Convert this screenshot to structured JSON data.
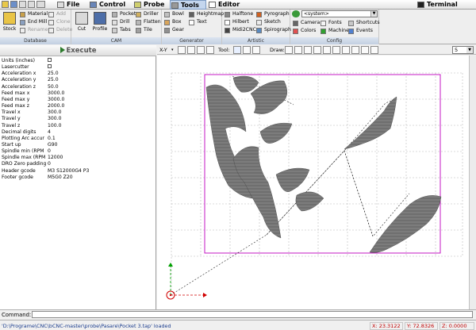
{
  "menubar": {
    "items": [
      {
        "label": "File",
        "icon": "file-icon",
        "active": false
      },
      {
        "label": "Control",
        "icon": "control-icon",
        "active": false
      },
      {
        "label": "Probe",
        "icon": "probe-icon",
        "active": false
      },
      {
        "label": "Tools",
        "icon": "tools-icon",
        "active": true
      },
      {
        "label": "Editor",
        "icon": "editor-icon",
        "active": false
      }
    ],
    "terminal_label": "Terminal"
  },
  "ribbon": {
    "database": {
      "label": "Database",
      "stock_label": "Stock",
      "small": [
        "Material",
        "End Mill",
        "Rename",
        "Add",
        "Clone",
        "Delete"
      ]
    },
    "cam": {
      "label": "CAM",
      "cut_label": "Cut",
      "profile_label": "Profile",
      "small": [
        "Pocket",
        "Drill",
        "Tabs",
        "Driller",
        "Flatten",
        "Tile"
      ]
    },
    "generator": {
      "label": "Generator",
      "small": [
        "Bowl",
        "Box",
        "Gear",
        "Heightmap",
        "Text"
      ]
    },
    "artistic": {
      "label": "Artistic",
      "small": [
        "Halftone",
        "Hilbert",
        "Midi2CNC",
        "Pyrograph",
        "Sketch",
        "Spirograph"
      ]
    },
    "config": {
      "label": "Config",
      "dropdown_value": "<system>",
      "small": [
        "Camera",
        "Colors",
        "Fonts",
        "Machine",
        "Shortcuts",
        "Events"
      ]
    }
  },
  "left_panel": {
    "execute_label": "Execute",
    "properties": [
      {
        "label": "Units (inches)",
        "value": "",
        "checkbox": true
      },
      {
        "label": "Lasercutter",
        "value": "",
        "checkbox": true
      },
      {
        "label": "Acceleration x",
        "value": "25.0"
      },
      {
        "label": "Acceleration y",
        "value": "25.0"
      },
      {
        "label": "Acceleration z",
        "value": "50.0"
      },
      {
        "label": "Feed max x",
        "value": "3000.0"
      },
      {
        "label": "Feed max y",
        "value": "3000.0"
      },
      {
        "label": "Feed max z",
        "value": "2000.0"
      },
      {
        "label": "Travel x",
        "value": "300.0"
      },
      {
        "label": "Travel y",
        "value": "300.0"
      },
      {
        "label": "Travel z",
        "value": "100.0"
      },
      {
        "label": "Decimal digits",
        "value": "4"
      },
      {
        "label": "Plotting Arc accur",
        "value": "0.1"
      },
      {
        "label": "Start up",
        "value": "G90"
      },
      {
        "label": "Spindle min (RPM",
        "value": "0"
      },
      {
        "label": "Spindle max (RPM",
        "value": "12000"
      },
      {
        "label": "DRO Zero padding",
        "value": "0"
      },
      {
        "label": "Header gcode",
        "value": "M3 S12000G4 P3"
      },
      {
        "label": "Footer gcode",
        "value": "M5G0 Z20"
      }
    ]
  },
  "canvas_toolbar": {
    "view_label": "X-Y",
    "tool_label": "Tool:",
    "draw_label": "Draw:",
    "zoom_value": "5"
  },
  "command": {
    "label": "Command:",
    "value": ""
  },
  "status": {
    "message": "'D:\\Programe\\CNC\\bCNC-master\\probe\\Pasare\\Pocket 3.tap' loaded",
    "x": "X: 23.3122",
    "y": "Y: 72.8326",
    "z": "Z: 0.0000"
  },
  "colors": {
    "margin_box": "#c000c0",
    "grid": "#b8b8b8",
    "toolpath_fill": "#6f6f6f",
    "axis_x": "#d00000",
    "axis_y": "#00a000",
    "status_text": "#1b3d8e"
  }
}
